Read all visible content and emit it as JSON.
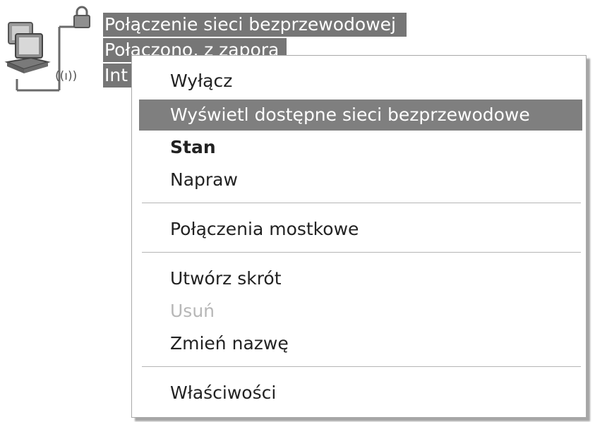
{
  "connection": {
    "name": "Połączenie sieci bezprzewodowej",
    "status": "Połączono, z zaporą",
    "device_truncated": "Int",
    "icons": [
      "network-computers-icon",
      "lock-icon",
      "wireless-signal-icon"
    ]
  },
  "context_menu": {
    "items": [
      {
        "label": "Wyłącz",
        "state": "normal"
      },
      {
        "label": "Wyświetl dostępne sieci bezprzewodowe",
        "state": "highlighted"
      },
      {
        "label": "Stan",
        "state": "default-bold"
      },
      {
        "label": "Napraw",
        "state": "normal"
      },
      {
        "label": "Połączenia mostkowe",
        "state": "normal"
      },
      {
        "label": "Utwórz skrót",
        "state": "normal"
      },
      {
        "label": "Usuń",
        "state": "disabled"
      },
      {
        "label": "Zmień nazwę",
        "state": "normal"
      },
      {
        "label": "Właściwości",
        "state": "normal"
      }
    ]
  },
  "colors": {
    "highlight": "#7f7f7f",
    "label_highlight": "#767676",
    "disabled_text": "#b7b7b7"
  }
}
